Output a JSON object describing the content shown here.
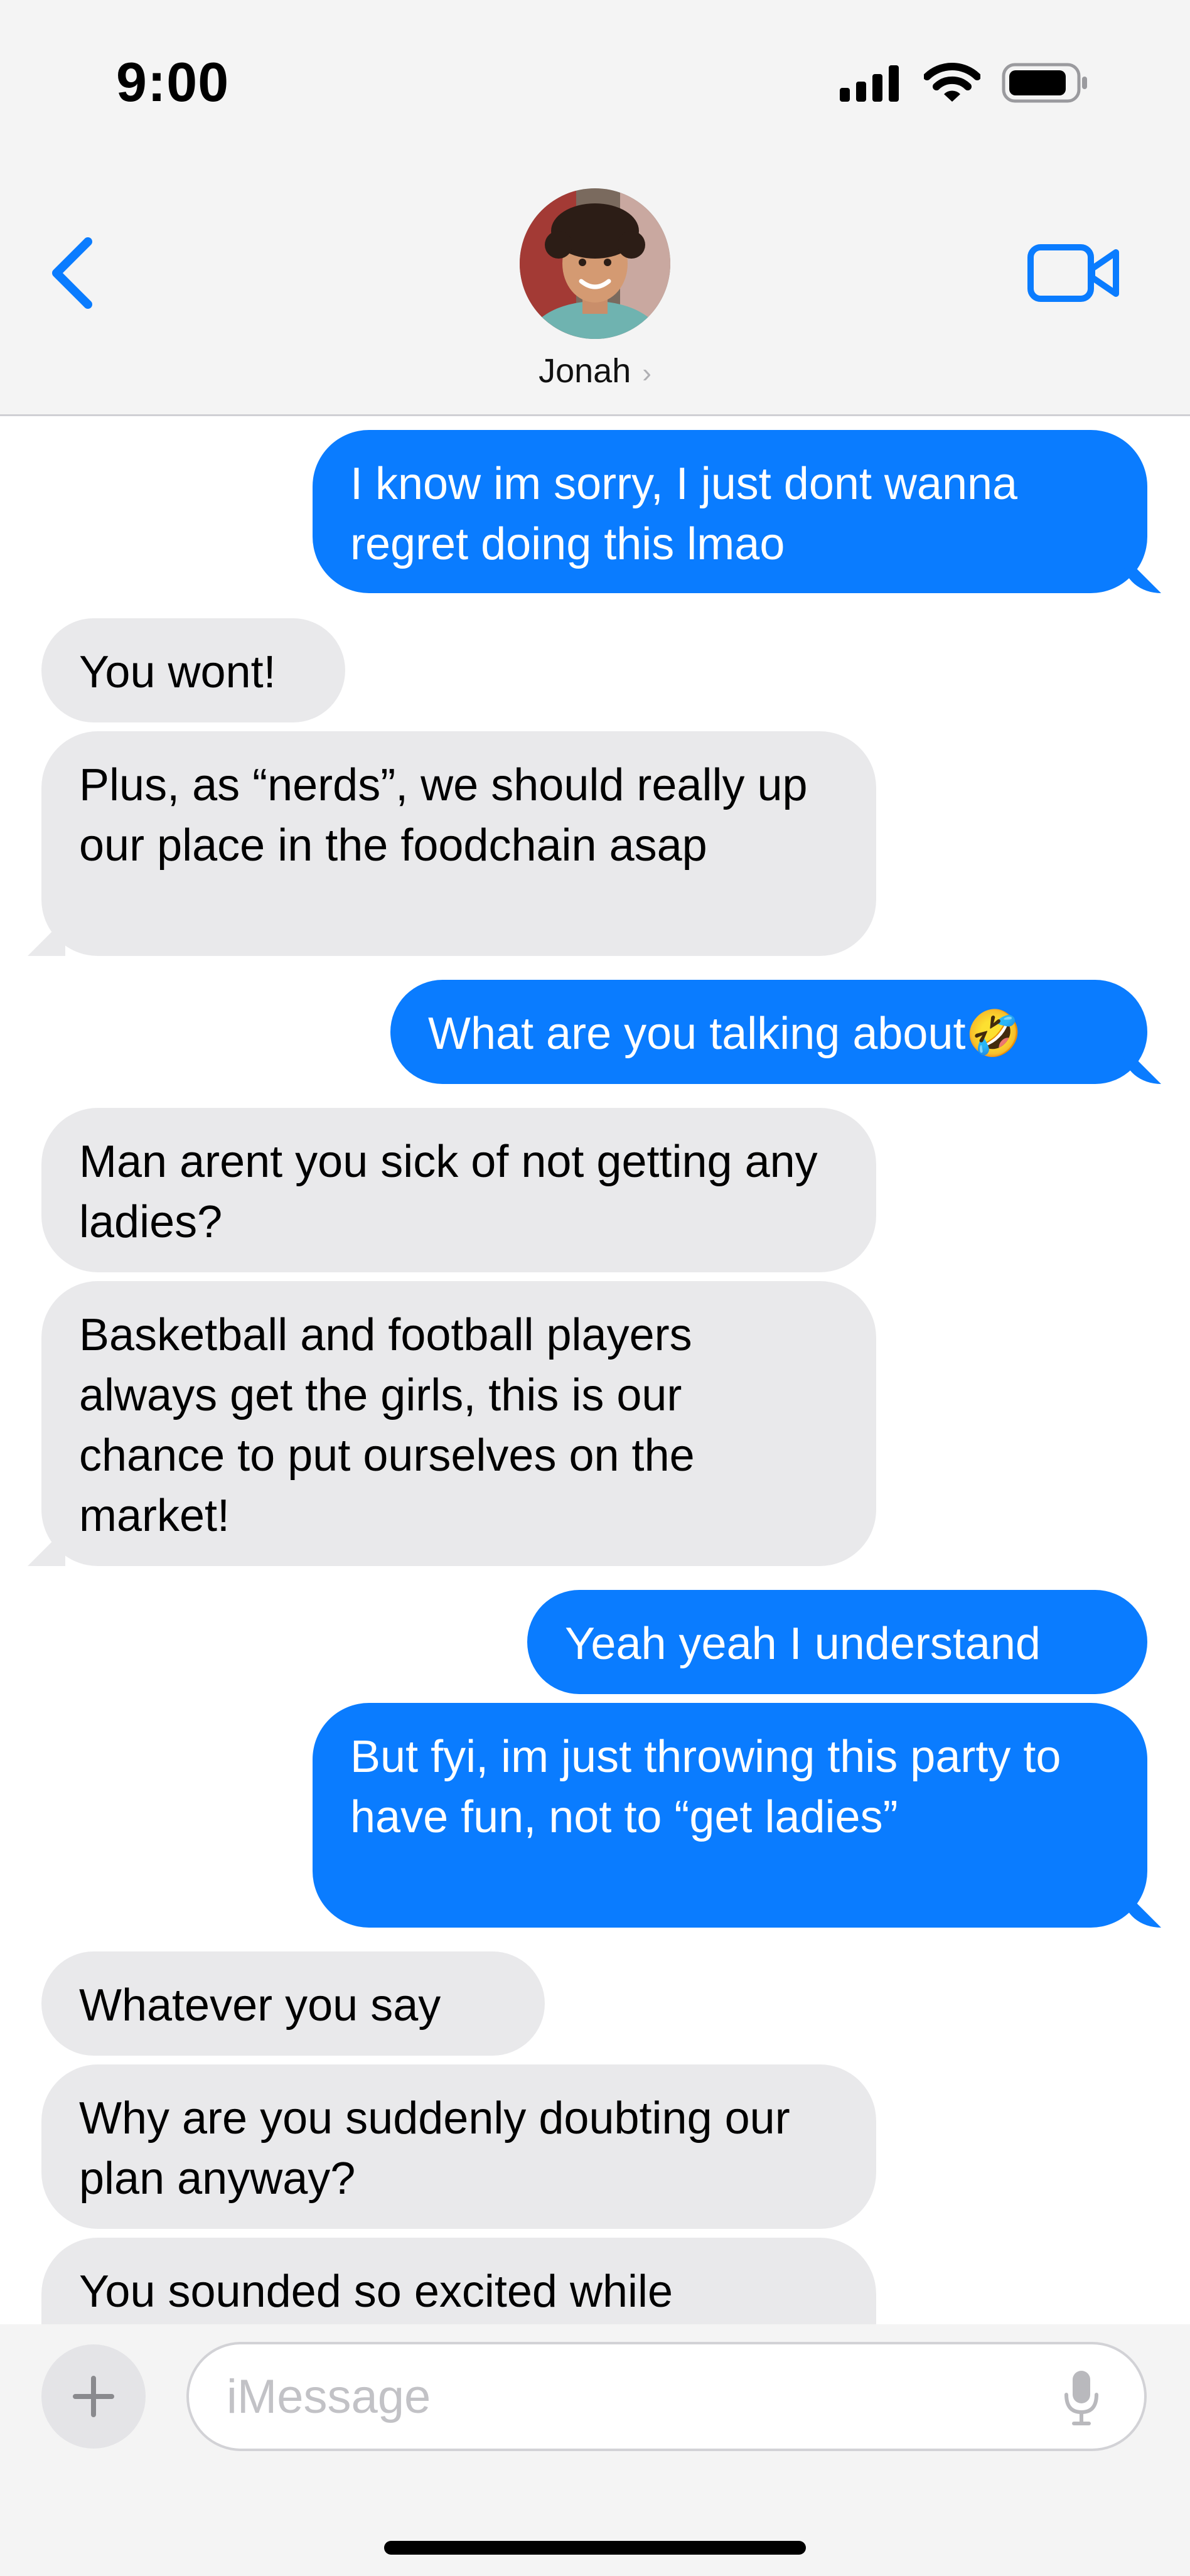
{
  "status": {
    "time": "9:00"
  },
  "header": {
    "contact_name": "Jonah"
  },
  "messages": [
    {
      "type": "sent",
      "text": "I know im sorry, I just dont wanna regret doing this lmao"
    },
    {
      "type": "received",
      "text": "You wont!"
    },
    {
      "type": "received",
      "text": "Plus, as “nerds”, we should really up our place in the foodchain asap"
    },
    {
      "type": "sent",
      "text": "What are you talking about🤣"
    },
    {
      "type": "received",
      "text": "Man arent you sick of not getting any ladies?"
    },
    {
      "type": "received",
      "text": "Basketball and football players always get the girls, this is our chance to put ourselves on the market!"
    },
    {
      "type": "sent",
      "text": "Yeah yeah I understand"
    },
    {
      "type": "sent",
      "text": "But fyi, im just throwing this party to have fun, not to “get ladies”"
    },
    {
      "type": "received",
      "text": "Whatever you say"
    },
    {
      "type": "received",
      "text": "Why are you suddenly doubting our plan anyway?"
    },
    {
      "type": "received",
      "text": "You sounded so excited while"
    }
  ],
  "composer": {
    "placeholder": "iMessage"
  },
  "colors": {
    "sent": "#0a7cff",
    "received": "#e9e9eb",
    "accent": "#0a7cff"
  },
  "icons": [
    "back-chevron-icon",
    "video-call-icon",
    "signal-icon",
    "wifi-icon",
    "battery-icon",
    "plus-icon",
    "mic-icon"
  ]
}
